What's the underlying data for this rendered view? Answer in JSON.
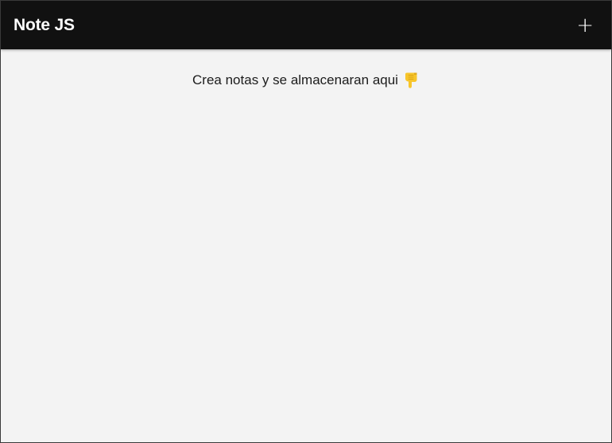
{
  "header": {
    "title": "Note JS",
    "add_label": "+"
  },
  "main": {
    "empty_message": "Crea notas y se almacenaran aqui",
    "empty_icon": "pointing-down-hand-icon"
  },
  "colors": {
    "header_bg": "#111111",
    "page_bg": "#f3f3f3",
    "icon_color": "#f7c52b"
  }
}
